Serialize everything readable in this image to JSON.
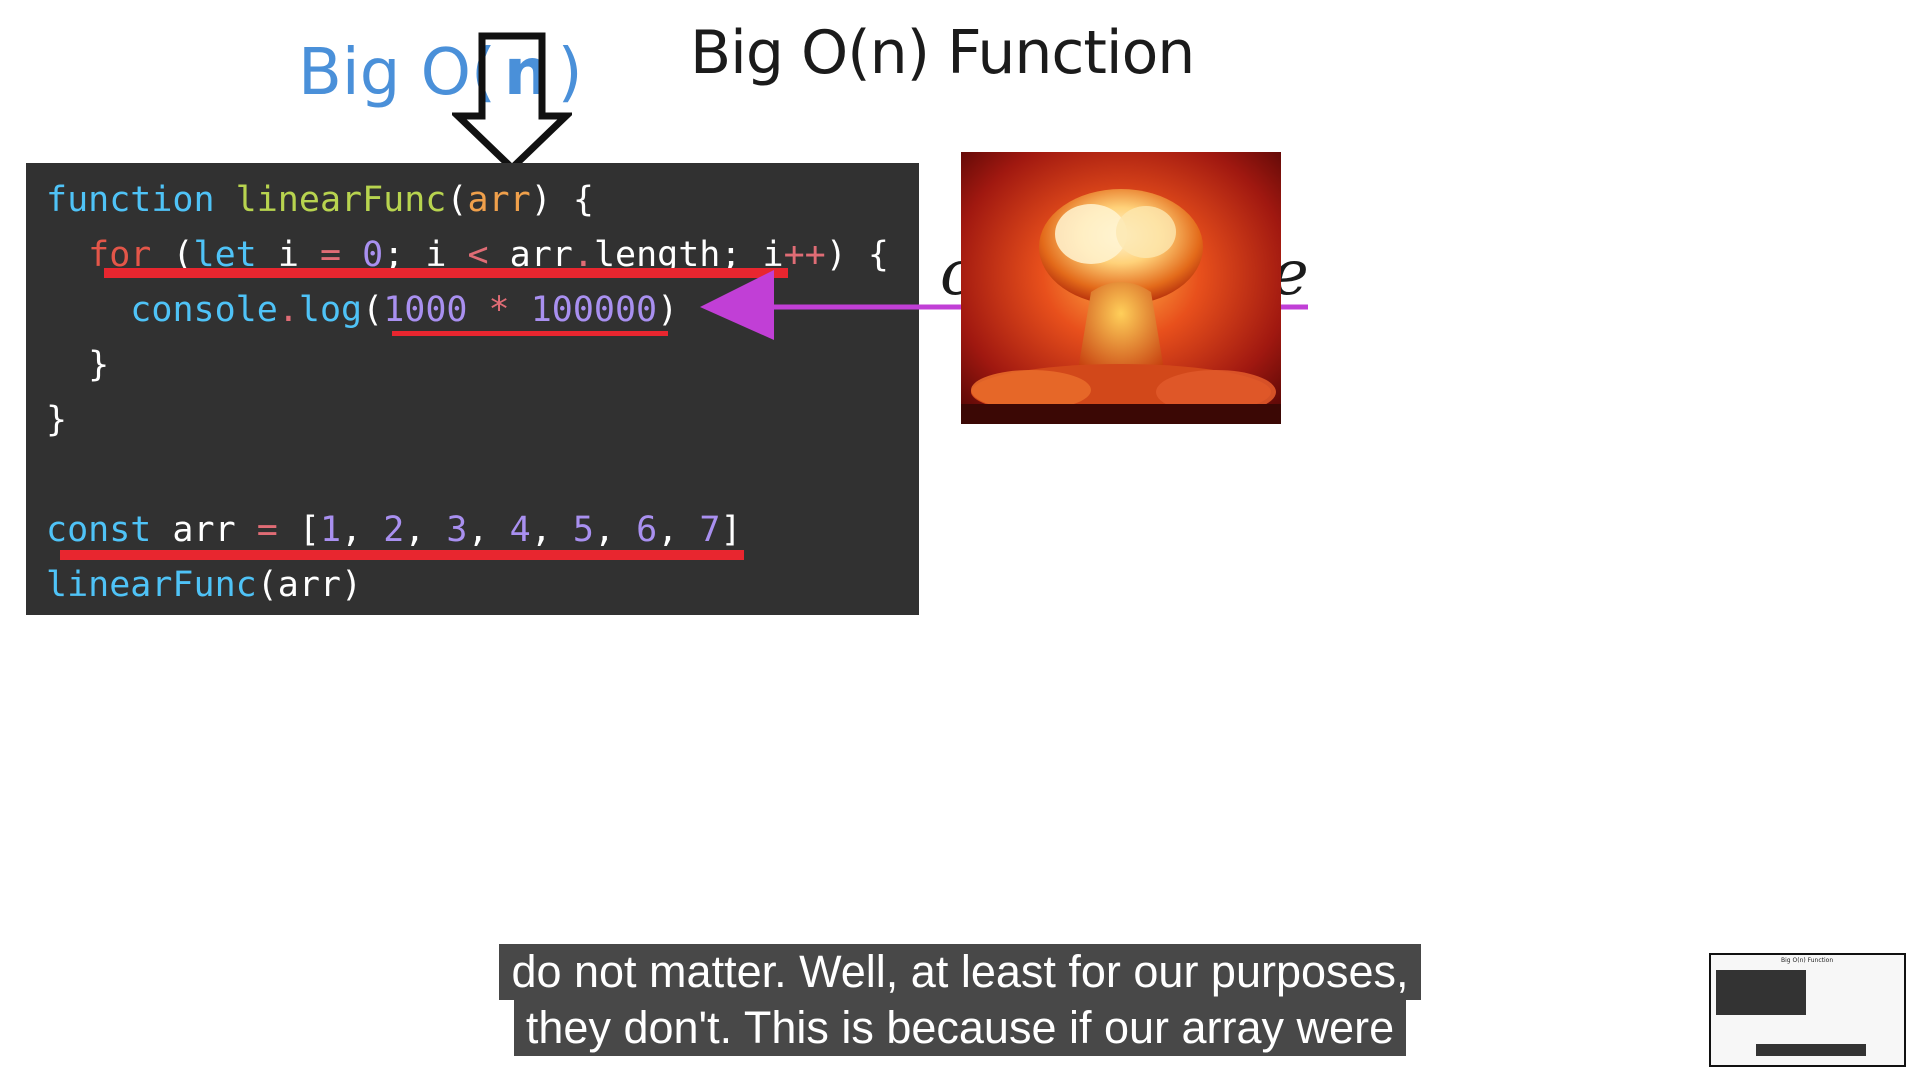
{
  "slide": {
    "title": "Big O(n) Function",
    "big_o_prefix": "Big O(",
    "big_o_n": "n",
    "big_o_suffix": ")",
    "cursive_left": "c",
    "cursive_right": "e"
  },
  "code": {
    "line1": {
      "kw": "function",
      "fn": "linearFunc",
      "open": "(",
      "param": "arr",
      "close": ") {"
    },
    "line2": {
      "kw_for": "for",
      "open": " (",
      "kw_let": "let",
      "var": " i ",
      "eq": "=",
      "zero": " 0",
      "semi": "; i ",
      "lt": "<",
      "arr": " arr",
      "dot": ".",
      "length": "length; i",
      "inc": "++",
      "close": ") {"
    },
    "line3": {
      "obj": "console",
      "dot": ".",
      "method": "log",
      "open": "(",
      "n1": "1000",
      "star": " * ",
      "n2": "100000",
      "close": ")"
    },
    "line4": "}",
    "line5": "}",
    "line7": {
      "kw": "const",
      "var": " arr ",
      "eq": "=",
      "open": " [",
      "n1": "1",
      "c1": ", ",
      "n2": "2",
      "c2": ", ",
      "n3": "3",
      "c3": ", ",
      "n4": "4",
      "c4": ", ",
      "n5": "5",
      "c5": ", ",
      "n6": "6",
      "c6": ", ",
      "n7": "7",
      "close": "]"
    },
    "line8": {
      "fn": "linearFunc",
      "args": "(arr)"
    }
  },
  "caption": {
    "line1": "do not matter. Well, at least for our purposes,",
    "line2": "they don't. This is because if our array were"
  },
  "thumbnail": {
    "title": "Big O(n) Function"
  },
  "colors": {
    "code_bg": "#313131",
    "keyword": "#4fc3f7",
    "function": "#b8d44f",
    "number": "#a990f0",
    "underline_red": "#e8262f",
    "arrow_purple": "#c13fd6",
    "big_o_blue": "#4a90d9"
  }
}
